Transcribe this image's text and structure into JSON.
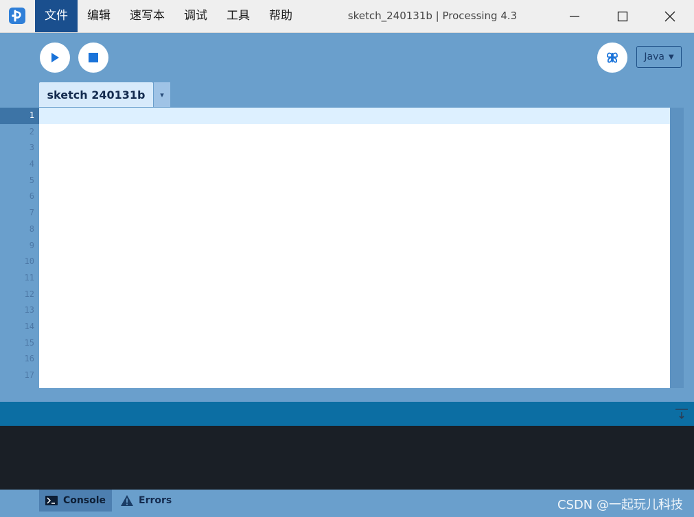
{
  "window": {
    "title": "sketch_240131b | Processing 4.3"
  },
  "menu": {
    "items": [
      {
        "label": "文件",
        "active": true
      },
      {
        "label": "编辑"
      },
      {
        "label": "速写本"
      },
      {
        "label": "调试"
      },
      {
        "label": "工具"
      },
      {
        "label": "帮助"
      }
    ]
  },
  "toolbar": {
    "run_icon": "play-icon",
    "stop_icon": "stop-icon",
    "debug_icon": "butterfly-icon",
    "mode": "Java",
    "mode_arrow": "▼"
  },
  "tabs": {
    "active": "sketch 240131b",
    "menu_arrow": "▾"
  },
  "editor": {
    "line_numbers": [
      "1",
      "2",
      "3",
      "4",
      "5",
      "6",
      "7",
      "8",
      "9",
      "10",
      "11",
      "12",
      "13",
      "14",
      "15",
      "16",
      "17"
    ],
    "current_line": 1,
    "content": ""
  },
  "bottom_tabs": {
    "console": "Console",
    "errors": "Errors"
  },
  "watermark": "CSDN @一起玩儿科技",
  "colors": {
    "accent": "#1a4f8e",
    "background": "#6a9fcc",
    "console": "#1a1f26",
    "console_bar": "#0c6ea3"
  }
}
